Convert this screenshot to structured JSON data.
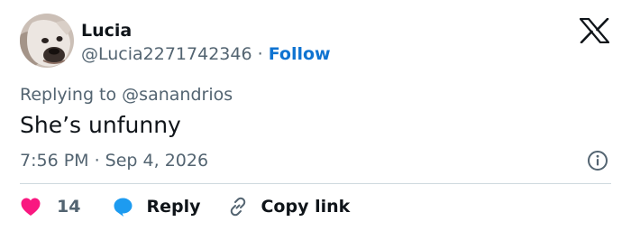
{
  "user": {
    "name": "Lucia",
    "handle": "@Lucia2271742346",
    "separator": "·",
    "follow_label": "Follow"
  },
  "reply": {
    "prefix": "Replying to",
    "mention": "@sanandrios"
  },
  "tweet": {
    "text": "She’s unfunny",
    "timestamp": "7:56 PM · Sep 4, 2026"
  },
  "actions": {
    "like_count": "14",
    "reply_label": "Reply",
    "copy_label": "Copy link"
  },
  "icons": {
    "brand": "x-logo-icon",
    "info": "info-icon",
    "like": "heart-icon",
    "reply": "reply-bubble-icon",
    "copy": "link-icon"
  },
  "colors": {
    "like": "#f91880",
    "reply_icon": "#1d9bf0",
    "follow": "#0f73d1",
    "secondary_text": "#536471",
    "primary_text": "#0f1419"
  }
}
